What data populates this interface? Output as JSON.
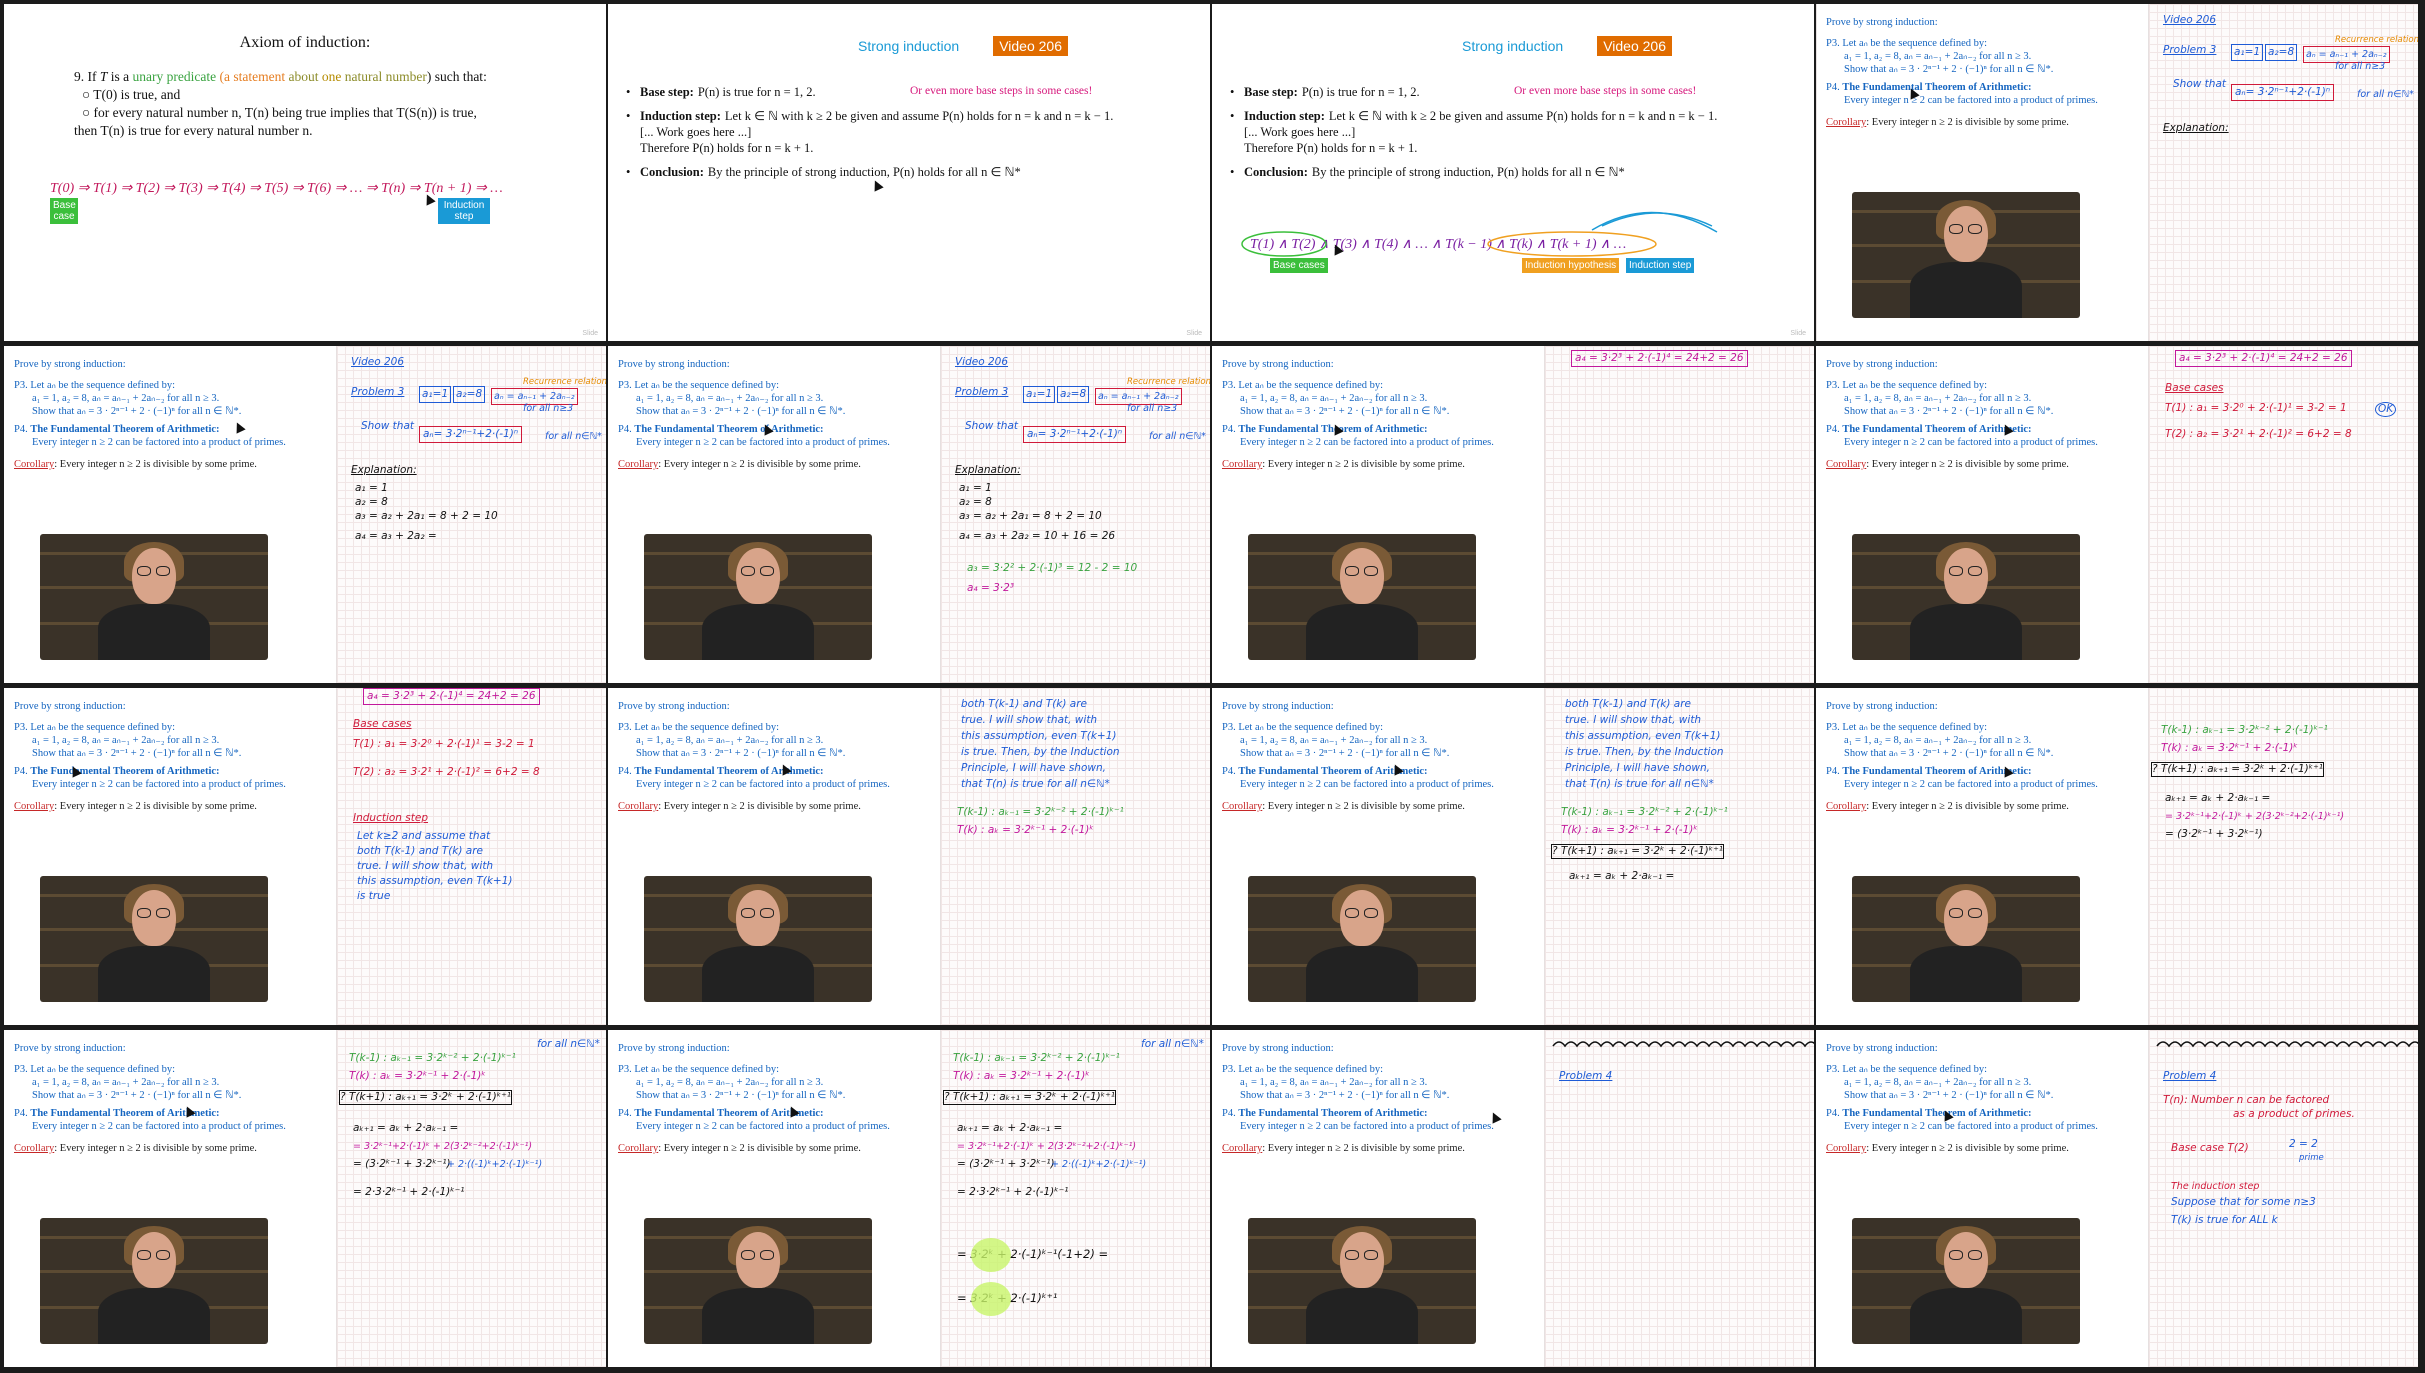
{
  "slide1": {
    "title": "Axiom of induction:",
    "line1": [
      "9. If ",
      "T",
      " is a ",
      "unary",
      " ",
      "predicate",
      " (",
      "a",
      " ",
      "statement",
      " ",
      "about",
      " ",
      "one",
      " ",
      "natural number",
      ") such that:"
    ],
    "line2": "○ T(0) is true, and",
    "line3": "○ for every natural number n, T(n) being true implies that T(S(n)) is true,",
    "line4": "then T(n) is true for every natural number n.",
    "chain": "T(0) ⇒ T(1) ⇒ T(2) ⇒ T(3) ⇒ T(4) ⇒ T(5) ⇒ T(6) ⇒ … ⇒ T(n) ⇒ T(n + 1) ⇒ …",
    "base_tag": "Base case",
    "step_tag": "Induction step"
  },
  "strong": {
    "title": "Strong induction",
    "video": "Video 206",
    "base_label": "Base step:",
    "base_text": "P(n) is true for n = 1, 2.",
    "more_base": "Or even more base steps in some cases!",
    "ind_label": "Induction step:",
    "ind_text": "Let k ∈ ℕ with k ≥ 2 be given and assume P(n) holds for n = k and n = k − 1.",
    "work": "[... Work goes here ...]",
    "therefore": "Therefore P(n) holds for n = k + 1.",
    "concl_label": "Conclusion:",
    "concl_text": "By the principle of strong induction, P(n) holds for all n ∈ ℕ*",
    "chain": "T(1)  ∧  T(2)  ∧  T(3)  ∧  T(4)  ∧  …  ∧  T(k − 1)  ∧  T(k)  ∧  T(k + 1)  ∧  …",
    "tag_base": "Base cases",
    "tag_hyp": "Induction hypothesis",
    "tag_step": "Induction step"
  },
  "problems": {
    "heading": "Prove by strong induction:",
    "p3_num": "P3.",
    "p3_l1": "Let aₙ be the sequence defined by:",
    "p3_l2": "a₁ = 1, a₂ = 8, aₙ = aₙ₋₁ + 2aₙ₋₂ for all n ≥ 3.",
    "p3_l3": "Show that aₙ = 3 · 2ⁿ⁻¹ + 2 · (−1)ⁿ for all n ∈ ℕ*.",
    "p4_num": "P4.",
    "p4_title": "The Fundamental Theorem of Arithmetic:",
    "p4_text": "Every integer n ≥ 2 can be factored into a product of primes.",
    "cor_label": "Corollary",
    "cor_text": ": Every integer n ≥ 2 is divisible by some prime."
  },
  "notes": {
    "video": "Video 206",
    "problem3": "Problem 3",
    "problem4": "Problem 4",
    "recurrence_tag": "Recurrence relation",
    "rec": "aₙ = aₙ₋₁ + 2aₙ₋₂",
    "for_all_3": "for all n≥3",
    "a1": "a₁=1",
    "a2": "a₂=8",
    "show_that": "Show that",
    "formula": "aₙ= 3·2ⁿ⁻¹+2·(-1)ⁿ",
    "for_all_n": "for all n∈ℕ*",
    "explanation": "Explanation:",
    "e1": "a₁ = 1",
    "e2": "a₂ = 8",
    "e3": "a₃ = a₂ + 2a₁ = 8 + 2 = 10",
    "e4": "a₄ = a₃ + 2a₂ =",
    "e4b": "a₄ = a₃ + 2a₂ = 10 + 16 = 26",
    "g3": "a₃ = 3·2² + 2·(-1)³ = 12 - 2 = 10",
    "g4": "a₄ = 3·2³",
    "a4full": "a₄ = 3·2³ + 2·(-1)⁴ = 24+2 = 26",
    "base_cases": "Base cases",
    "t1": "T(1) :   a₁ = 3·2⁰ + 2·(-1)¹ = 3-2 = 1",
    "t2": "T(2) :   a₂ = 3·2¹ + 2·(-1)² = 6+2 = 8",
    "ok": "OK",
    "ind_step": "Induction step",
    "is1": "Let k≥2 and assume that",
    "is2": "both T(k-1) and T(k) are",
    "is3": "true. I will show that, with",
    "is4": "this assumption, even T(k+1)",
    "is5": "is true",
    "is6": "is true. Then, by the Induction",
    "is7": "Principle, I will have shown,",
    "is8": "that T(n) is true for all n∈ℕ*",
    "tk1": "T(k-1) :   aₖ₋₁ = 3·2ᵏ⁻² + 2·(-1)ᵏ⁻¹",
    "tk": "T(k) :   aₖ = 3·2ᵏ⁻¹ + 2·(-1)ᵏ",
    "tkp": "? T(k+1) :   aₖ₊₁ = 3·2ᵏ + 2·(-1)ᵏ⁺¹",
    "ak": "aₖ =",
    "r1": "aₖ₊₁ = aₖ + 2·aₖ₋₁ =",
    "r2": "= 3·2ᵏ⁻¹+2·(-1)ᵏ + 2(3·2ᵏ⁻²+2·(-1)ᵏ⁻¹)",
    "r3": "= (3·2ᵏ⁻¹ + 3·2ᵏ⁻¹)",
    "r4": "+ 2·((-1)ᵏ+2·(-1)ᵏ⁻¹)",
    "r5": "= 2·3·2ᵏ⁻¹ + 2·(-1)ᵏ⁻¹",
    "r6": "= 3·2ᵏ + 2·(-1)ᵏ⁻¹(-1+2) =",
    "r7": "= 3·2ᵏ + 2·(-1)ᵏ⁺¹",
    "tn4": "T(n): Number n can be factored",
    "tn4b": "as a product of primes.",
    "bc4": "Base case   T(2)",
    "bc4b": "2 = 2",
    "bc4c": "prime",
    "is4a": "The induction step",
    "is4b": "Suppose that for some n≥3",
    "is4c": "T(k) is true for ALL k"
  },
  "page_num": "Slide"
}
